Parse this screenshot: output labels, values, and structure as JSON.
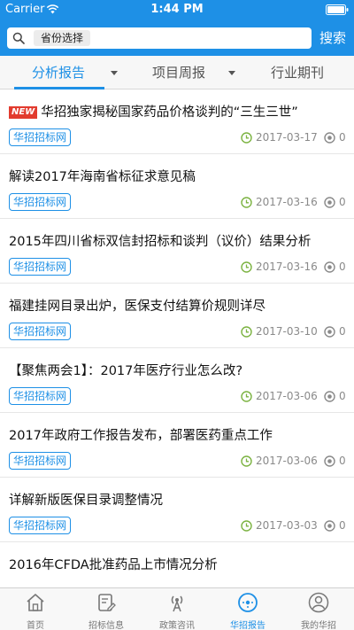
{
  "status_bar": {
    "carrier": "Carrier",
    "time": "1:44 PM"
  },
  "search": {
    "province_chip": "省份选择",
    "button_label": "搜索",
    "icon": "search-icon"
  },
  "tabs": [
    {
      "label": "分析报告",
      "active": true,
      "has_dropdown": true
    },
    {
      "label": "项目周报",
      "active": false,
      "has_dropdown": true
    },
    {
      "label": "行业期刊",
      "active": false,
      "has_dropdown": false
    }
  ],
  "articles": [
    {
      "badge": "NEW",
      "title": "华招独家揭秘国家药品价格谈判的“三生三世”",
      "source": "华招招标网",
      "date": "2017-03-17",
      "views": "0"
    },
    {
      "badge": "",
      "title": "解读2017年海南省标征求意见稿",
      "source": "华招招标网",
      "date": "2017-03-16",
      "views": "0"
    },
    {
      "badge": "",
      "title": "2015年四川省标双信封招标和谈判（议价）结果分析",
      "source": "华招招标网",
      "date": "2017-03-16",
      "views": "0"
    },
    {
      "badge": "",
      "title": "福建挂网目录出炉，医保支付结算价规则详尽",
      "source": "华招招标网",
      "date": "2017-03-10",
      "views": "0"
    },
    {
      "badge": "",
      "title": "【聚焦两会1】：2017年医疗行业怎么改?",
      "source": "华招招标网",
      "date": "2017-03-06",
      "views": "0"
    },
    {
      "badge": "",
      "title": "2017年政府工作报告发布，部署医药重点工作",
      "source": "华招招标网",
      "date": "2017-03-06",
      "views": "0"
    },
    {
      "badge": "",
      "title": "详解新版医保目录调整情况",
      "source": "华招招标网",
      "date": "2017-03-03",
      "views": "0"
    },
    {
      "badge": "",
      "title": "2016年CFDA批准药品上市情况分析",
      "source": "",
      "date": "",
      "views": ""
    }
  ],
  "tabbar": [
    {
      "label": "首页",
      "icon": "home-icon",
      "active": false
    },
    {
      "label": "招标信息",
      "icon": "document-edit-icon",
      "active": false
    },
    {
      "label": "政策咨讯",
      "icon": "broadcast-icon",
      "active": false
    },
    {
      "label": "华招报告",
      "icon": "compass-icon",
      "active": true
    },
    {
      "label": "我的华招",
      "icon": "user-icon",
      "active": false
    }
  ],
  "colors": {
    "brand": "#1e90e6",
    "new_badge": "#e23b2e",
    "clock": "#7cb342",
    "meta_text": "#8a8a8a"
  }
}
